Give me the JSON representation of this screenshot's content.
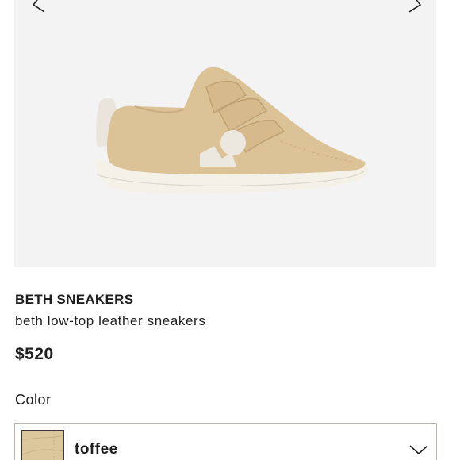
{
  "product": {
    "brand": "BETH SNEAKERS",
    "subtitle": "beth low-top leather sneakers",
    "price": "$520"
  },
  "carousel": {
    "prev_icon": "chevron-left-icon",
    "next_icon": "chevron-right-icon"
  },
  "color": {
    "label": "Color",
    "selected": "toffee",
    "swatch_color": "#dcc79c",
    "dropdown_icon": "chevron-down-icon"
  },
  "colors": {
    "image_background": "#f3f3f3",
    "shoe_suede": "#dcc297",
    "shoe_sole": "#f4f1e8",
    "logo": "#ece7df"
  }
}
